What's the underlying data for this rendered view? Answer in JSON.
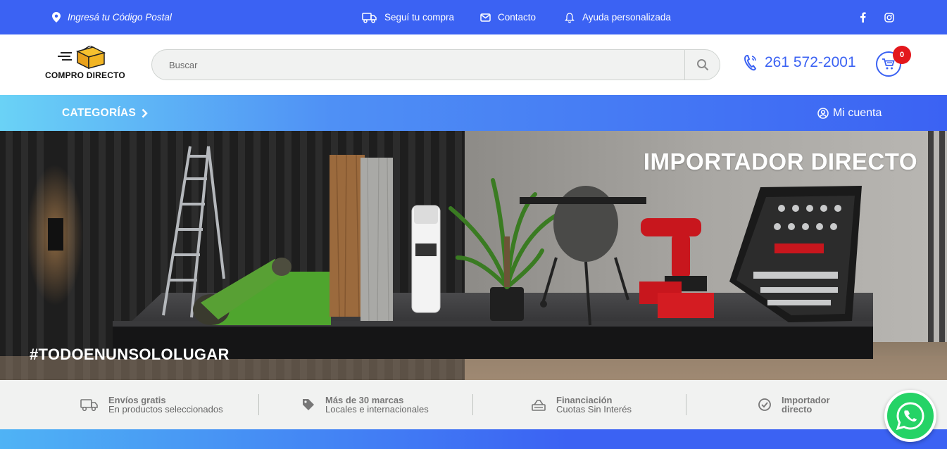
{
  "topbar": {
    "postal_label": "Ingresá tu Código Postal",
    "follow_label": "Seguí tu compra",
    "contact_label": "Contacto",
    "help_label": "Ayuda personalizada",
    "social": [
      "facebook-icon",
      "instagram-icon"
    ]
  },
  "header": {
    "logo_text": "COMPRO DIRECTO",
    "search_placeholder": "Buscar",
    "phone": "261 572-2001",
    "cart_count": "0"
  },
  "nav": {
    "categories_label": "CATEGORÍAS",
    "account_label": "Mi cuenta"
  },
  "hero": {
    "title": "IMPORTADOR DIRECTO",
    "tagline": "#TODOENUNSOLOLUGAR"
  },
  "features": [
    {
      "title": "Envíos gratis",
      "subtitle": "En productos seleccionados",
      "icon": "truck-icon"
    },
    {
      "title": "Más de 30 marcas",
      "subtitle": "Locales e internacionales",
      "icon": "tag-icon"
    },
    {
      "title": "Financiación",
      "subtitle": "Cuotas Sin Interés",
      "icon": "cash-icon"
    },
    {
      "title": "Importador",
      "subtitle": "directo",
      "icon": "check-circle-icon"
    }
  ],
  "colors": {
    "primary": "#3b62f3",
    "accent_light": "#6ad2f6",
    "badge": "#e3171c",
    "whatsapp": "#25d366"
  }
}
